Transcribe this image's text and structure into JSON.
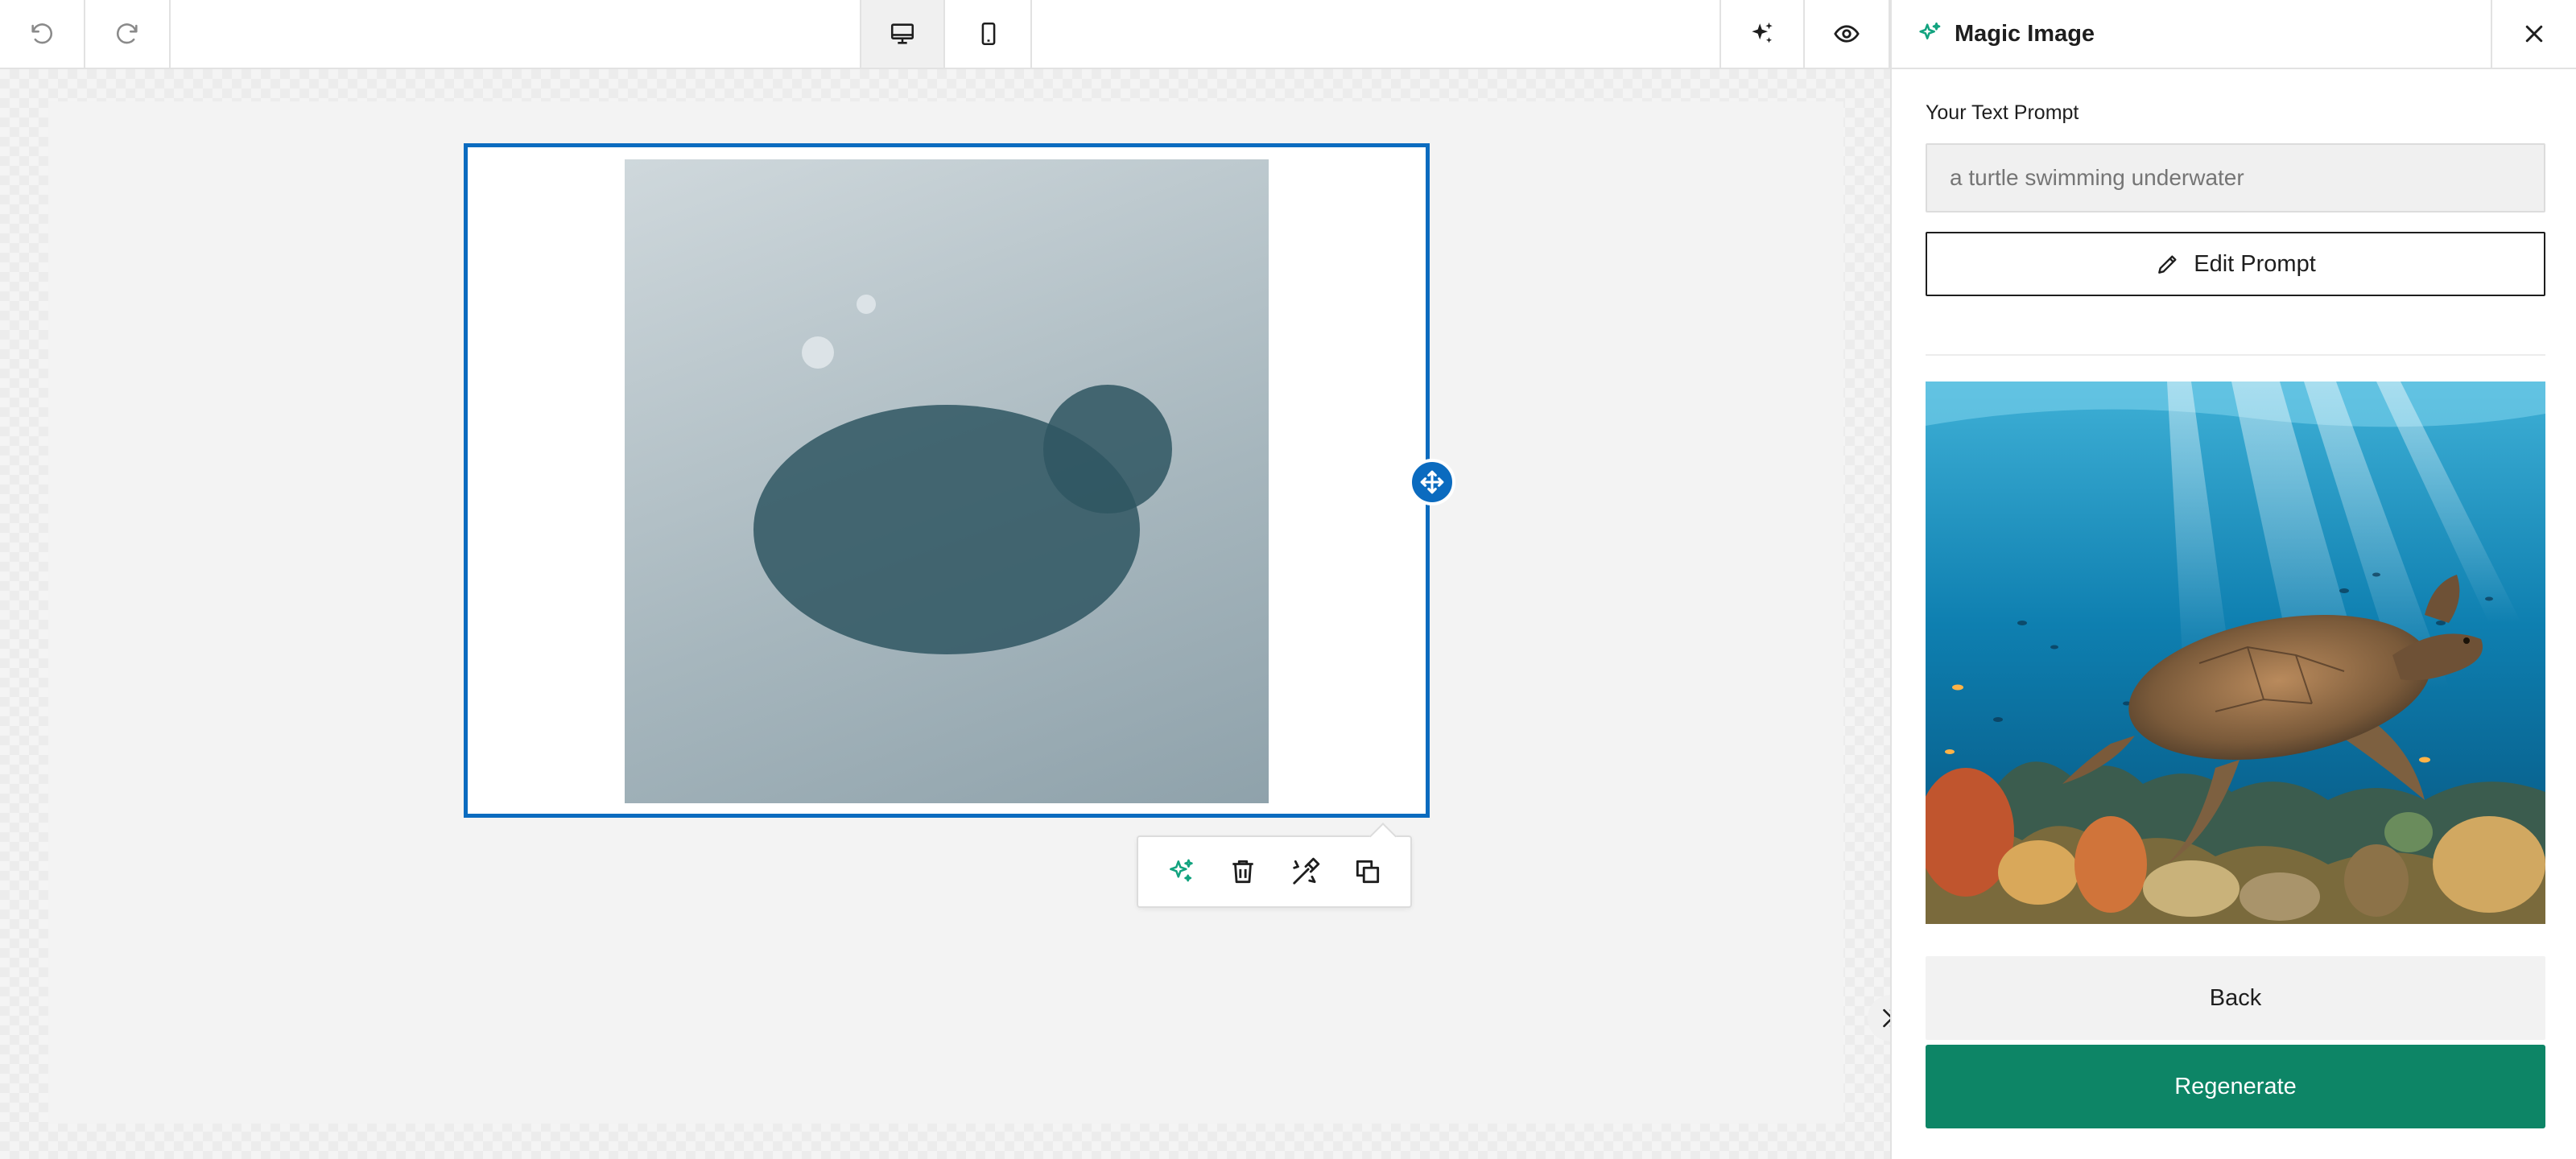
{
  "toolbar": {
    "undo_icon": "undo-icon",
    "redo_icon": "redo-icon",
    "desktop_icon": "desktop-icon",
    "mobile_icon": "mobile-icon",
    "ai_icon": "sparkles-icon",
    "preview_icon": "eye-icon"
  },
  "block_toolbar": {
    "items": [
      "sparkles-icon",
      "trash-icon",
      "edit-image-icon",
      "duplicate-icon"
    ]
  },
  "panel": {
    "title": "Magic Image",
    "prompt_label": "Your Text Prompt",
    "prompt_value": "a turtle swimming underwater",
    "edit_button": "Edit Prompt",
    "back_button": "Back",
    "regenerate_button": "Regenerate"
  },
  "colors": {
    "accent": "#0b6bbf",
    "primary": "#0d8566",
    "ai_green": "#12a37f"
  }
}
